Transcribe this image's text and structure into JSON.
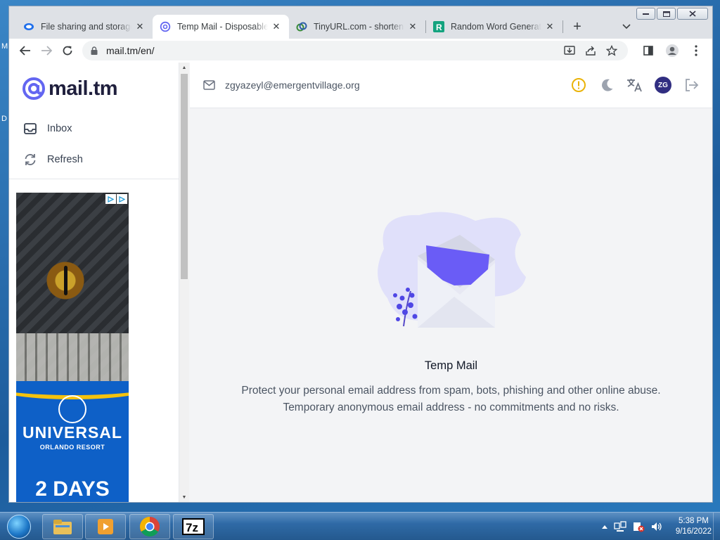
{
  "desktop": {
    "labels": [
      "M",
      "D"
    ]
  },
  "browser": {
    "tabs": [
      {
        "title": "File sharing and storage made simple",
        "favicon": "wetransfer-icon",
        "active": false
      },
      {
        "title": "Temp Mail - Disposable Temporary Email",
        "favicon": "mail-tm-icon",
        "active": true
      },
      {
        "title": "TinyURL.com - shorten that long URL",
        "favicon": "tinyurl-icon",
        "active": false
      },
      {
        "title": "Random Word Generator",
        "favicon": "random-word-icon",
        "active": false
      }
    ],
    "url": "mail.tm/en/"
  },
  "sidebar": {
    "logo_text": "mail.tm",
    "nav": [
      {
        "label": "Inbox",
        "icon": "inbox-icon"
      },
      {
        "label": "Refresh",
        "icon": "refresh-icon"
      }
    ]
  },
  "ad": {
    "brand": "UNIVERSAL",
    "sub": "ORLANDO RESORT",
    "headline": "2 DAYS"
  },
  "main": {
    "email": "zgyazeyl@emergentvillage.org",
    "avatar_initials": "ZG",
    "empty_title": "Temp Mail",
    "empty_desc_line1": "Protect your personal email address from spam, bots, phishing and other online abuse.",
    "empty_desc_line2": "Temporary anonymous email address - no commitments and no risks."
  },
  "taskbar": {
    "time": "5:38 PM",
    "date": "9/16/2022",
    "apps": [
      "file-explorer-icon",
      "media-player-icon",
      "chrome-icon",
      "7zip-icon"
    ],
    "seven_zip_label": "7z"
  },
  "colors": {
    "brand": "#6366f1",
    "brand_dark": "#312e81",
    "warning": "#eab308"
  }
}
